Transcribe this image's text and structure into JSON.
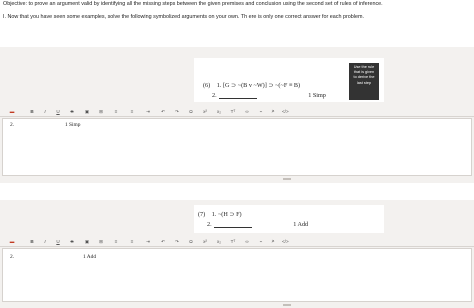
{
  "instructions": {
    "objective": "Objective: to prove an argument valid by identifying all the missing steps between the given premises and conclusion using the second set of rules of inference.",
    "task": "I. Now that you have seen some examples, solve the following symbolized arguments on your own. Th ere is only one correct answer for each problem."
  },
  "hint_box": {
    "lines": [
      "Use the rule",
      "that is given",
      "to derive the",
      "last step"
    ]
  },
  "toolbar": {
    "items": [
      {
        "name": "toolbar-highlight-button",
        "glyph": "▬",
        "color": "#c23b22"
      },
      {
        "name": "toolbar-bold-button",
        "glyph": "B",
        "color": "#555555"
      },
      {
        "name": "toolbar-italic-button",
        "glyph": "I",
        "color": "#555555"
      },
      {
        "name": "toolbar-underline-button",
        "glyph": "U",
        "color": "#555555"
      },
      {
        "name": "toolbar-strike-button",
        "glyph": "S",
        "color": "#555555"
      },
      {
        "name": "toolbar-image-button",
        "glyph": "▣",
        "color": "#555555"
      },
      {
        "name": "toolbar-table-button",
        "glyph": "⊞",
        "color": "#555555"
      },
      {
        "name": "toolbar-list-button",
        "glyph": "≡",
        "color": "#555555"
      },
      {
        "name": "toolbar-numbered-list-button",
        "glyph": "≡",
        "color": "#555555"
      },
      {
        "name": "toolbar-indent-button",
        "glyph": "⇥",
        "color": "#555555"
      },
      {
        "name": "toolbar-undo-button",
        "glyph": "↶",
        "color": "#555555"
      },
      {
        "name": "toolbar-redo-button",
        "glyph": "↷",
        "color": "#555555"
      },
      {
        "name": "toolbar-special-char-button",
        "glyph": "Ω",
        "color": "#555555"
      },
      {
        "name": "toolbar-superscript-button",
        "glyph": "x²",
        "color": "#555555"
      },
      {
        "name": "toolbar-subscript-button",
        "glyph": "x₂",
        "color": "#555555"
      },
      {
        "name": "toolbar-math-button",
        "glyph": "Tᵀ",
        "color": "#555555"
      },
      {
        "name": "toolbar-link-button",
        "glyph": "∞",
        "color": "#555555"
      },
      {
        "name": "toolbar-unlink-button",
        "glyph": "⌁",
        "color": "#555555"
      },
      {
        "name": "toolbar-format-button",
        "glyph": "ʲᵃ",
        "color": "#555555"
      },
      {
        "name": "toolbar-code-button",
        "glyph": "</>",
        "color": "#555555"
      }
    ]
  },
  "problems": [
    {
      "number": "(6)",
      "premise": "1. [G ⊃ ~(B v ~W)] ⊃ ~(~F ≡ B)",
      "step_label": "2.",
      "rule": "1 Simp",
      "answer_number": "2.",
      "answer_text": "1 Simp"
    },
    {
      "number": "(7)",
      "premise": "1. ~(H ⊃ F)",
      "step_label": "2.",
      "rule": "1 Add",
      "answer_number": "2.",
      "answer_text": "1 Add"
    }
  ]
}
